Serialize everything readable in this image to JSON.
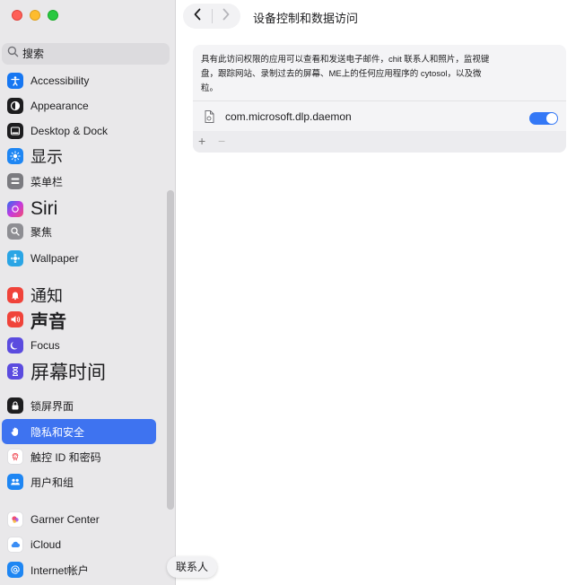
{
  "window": {
    "title": "设备控制和数据访问"
  },
  "search": {
    "placeholder": "搜索"
  },
  "sidebar": {
    "items": [
      {
        "label": "Accessibility",
        "icon": "accessibility-icon",
        "color": "#1677f2"
      },
      {
        "label": "Appearance",
        "icon": "appearance-icon",
        "color": "#1d1d1f"
      },
      {
        "label": "Desktop & Dock",
        "icon": "dock-icon",
        "color": "#1d1d1f"
      },
      {
        "label": "显示",
        "icon": "brightness-icon",
        "color": "#1e86f3"
      },
      {
        "label": "菜单栏",
        "icon": "menubar-icon",
        "color": "#7b7b80"
      },
      {
        "label": "Siri",
        "icon": "siri-icon",
        "color": "#6b3bd6"
      },
      {
        "label": "聚焦",
        "icon": "magnifier-icon",
        "color": "#8e8e93"
      },
      {
        "label": "Wallpaper",
        "icon": "wallpaper-icon",
        "color": "#2aa5e5"
      },
      {
        "label": "通知",
        "icon": "notification-icon",
        "color": "#f0433a"
      },
      {
        "label": "声音",
        "icon": "speaker-icon",
        "color": "#f0433a"
      },
      {
        "label": "Focus",
        "icon": "moon-icon",
        "color": "#5b4bdf"
      },
      {
        "label": "屏幕时间",
        "icon": "hourglass-icon",
        "color": "#5b4bdf"
      },
      {
        "label": "锁屏界面",
        "icon": "lock-screen-icon",
        "color": "#1d1d1f"
      },
      {
        "label": "隐私和安全",
        "icon": "hand-icon",
        "color": "#3e73f0"
      },
      {
        "label": "触控 ID 和密码",
        "icon": "fingerprint-icon",
        "color": "#ffffff"
      },
      {
        "label": "用户和组",
        "icon": "users-icon",
        "color": "#1e86f3"
      },
      {
        "label": "Garner Center",
        "icon": "game-center-icon",
        "color": "#ffffff"
      },
      {
        "label": "iCloud",
        "icon": "cloud-icon",
        "color": "#ffffff"
      },
      {
        "label": "Internet帐户",
        "icon": "at-icon",
        "color": "#1e86f3"
      }
    ]
  },
  "main": {
    "description": "具有此访问权限的应用可以查看和发送电子邮件，chit 联系人和照片，监视键盘，跟踪网站、录制过去的屏幕、ME上的任何应用程序的 cytosol，以及微粒。",
    "apps": [
      {
        "name": "com.microsoft.dlp.daemon",
        "enabled": true
      }
    ],
    "add_label": "+",
    "remove_label": "−"
  },
  "tooltip": {
    "text": "联系人"
  },
  "colors": {
    "accent": "#3478f6",
    "selection": "#3e73f0"
  }
}
